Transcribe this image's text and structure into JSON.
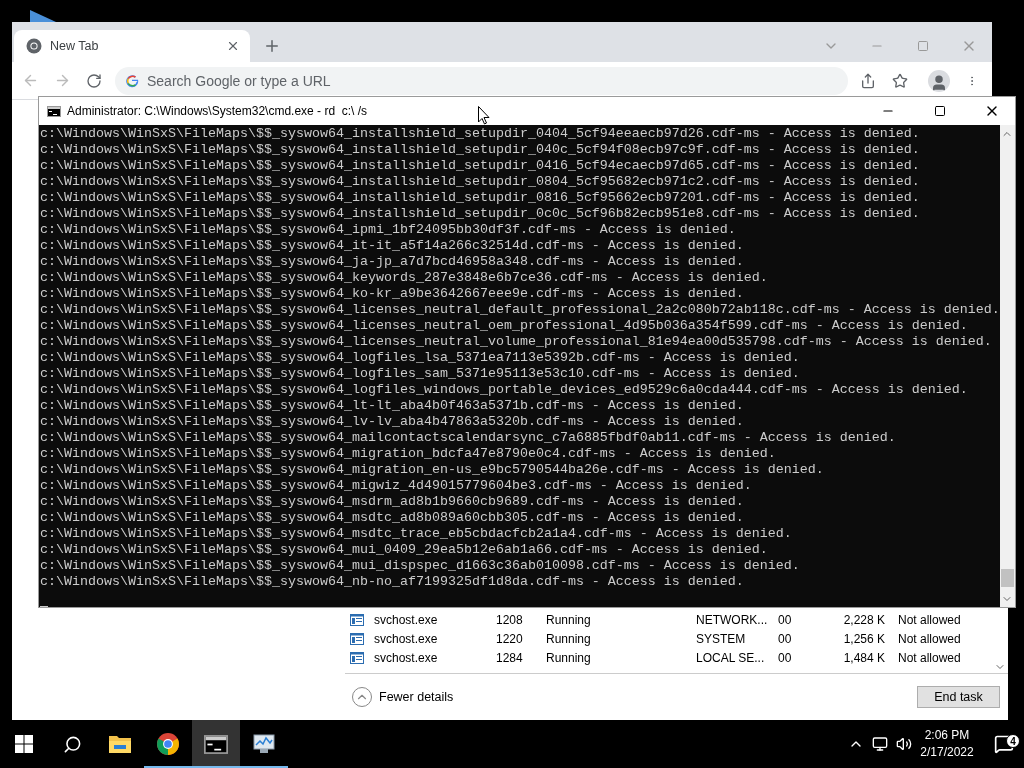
{
  "browser": {
    "tab": {
      "title": "New Tab",
      "selected": true
    },
    "omnibox": {
      "placeholder": "Search Google or type a URL"
    }
  },
  "console": {
    "title": "Administrator: C:\\Windows\\System32\\cmd.exe - rd  c:\\ /s",
    "lines": [
      "c:\\Windows\\WinSxS\\FileMaps\\$$_syswow64_installshield_setupdir_0404_5cf94eeaecb97d26.cdf-ms - Access is denied.",
      "c:\\Windows\\WinSxS\\FileMaps\\$$_syswow64_installshield_setupdir_040c_5cf94f08ecb97c9f.cdf-ms - Access is denied.",
      "c:\\Windows\\WinSxS\\FileMaps\\$$_syswow64_installshield_setupdir_0416_5cf94ecaecb97d65.cdf-ms - Access is denied.",
      "c:\\Windows\\WinSxS\\FileMaps\\$$_syswow64_installshield_setupdir_0804_5cf95682ecb971c2.cdf-ms - Access is denied.",
      "c:\\Windows\\WinSxS\\FileMaps\\$$_syswow64_installshield_setupdir_0816_5cf95662ecb97201.cdf-ms - Access is denied.",
      "c:\\Windows\\WinSxS\\FileMaps\\$$_syswow64_installshield_setupdir_0c0c_5cf96b82ecb951e8.cdf-ms - Access is denied.",
      "c:\\Windows\\WinSxS\\FileMaps\\$$_syswow64_ipmi_1bf24095bb30df3f.cdf-ms - Access is denied.",
      "c:\\Windows\\WinSxS\\FileMaps\\$$_syswow64_it-it_a5f14a266c32514d.cdf-ms - Access is denied.",
      "c:\\Windows\\WinSxS\\FileMaps\\$$_syswow64_ja-jp_a7d7bcd46958a348.cdf-ms - Access is denied.",
      "c:\\Windows\\WinSxS\\FileMaps\\$$_syswow64_keywords_287e3848e6b7ce36.cdf-ms - Access is denied.",
      "c:\\Windows\\WinSxS\\FileMaps\\$$_syswow64_ko-kr_a9be3642667eee9e.cdf-ms - Access is denied.",
      "c:\\Windows\\WinSxS\\FileMaps\\$$_syswow64_licenses_neutral_default_professional_2a2c080b72ab118c.cdf-ms - Access is denied.",
      "c:\\Windows\\WinSxS\\FileMaps\\$$_syswow64_licenses_neutral_oem_professional_4d95b036a354f599.cdf-ms - Access is denied.",
      "c:\\Windows\\WinSxS\\FileMaps\\$$_syswow64_licenses_neutral_volume_professional_81e94ea00d535798.cdf-ms - Access is denied.",
      "c:\\Windows\\WinSxS\\FileMaps\\$$_syswow64_logfiles_lsa_5371ea7113e5392b.cdf-ms - Access is denied.",
      "c:\\Windows\\WinSxS\\FileMaps\\$$_syswow64_logfiles_sam_5371e95113e53c10.cdf-ms - Access is denied.",
      "c:\\Windows\\WinSxS\\FileMaps\\$$_syswow64_logfiles_windows_portable_devices_ed9529c6a0cda444.cdf-ms - Access is denied.",
      "c:\\Windows\\WinSxS\\FileMaps\\$$_syswow64_lt-lt_aba4b0f463a5371b.cdf-ms - Access is denied.",
      "c:\\Windows\\WinSxS\\FileMaps\\$$_syswow64_lv-lv_aba4b47863a5320b.cdf-ms - Access is denied.",
      "c:\\Windows\\WinSxS\\FileMaps\\$$_syswow64_mailcontactscalendarsync_c7a6885fbdf0ab11.cdf-ms - Access is denied.",
      "c:\\Windows\\WinSxS\\FileMaps\\$$_syswow64_migration_bdcfa47e8790e0c4.cdf-ms - Access is denied.",
      "c:\\Windows\\WinSxS\\FileMaps\\$$_syswow64_migration_en-us_e9bc5790544ba26e.cdf-ms - Access is denied.",
      "c:\\Windows\\WinSxS\\FileMaps\\$$_syswow64_migwiz_4d49015779604be3.cdf-ms - Access is denied.",
      "c:\\Windows\\WinSxS\\FileMaps\\$$_syswow64_msdrm_ad8b1b9660cb9689.cdf-ms - Access is denied.",
      "c:\\Windows\\WinSxS\\FileMaps\\$$_syswow64_msdtc_ad8b089a60cbb305.cdf-ms - Access is denied.",
      "c:\\Windows\\WinSxS\\FileMaps\\$$_syswow64_msdtc_trace_eb5cbdacfcb2a1a4.cdf-ms - Access is denied.",
      "c:\\Windows\\WinSxS\\FileMaps\\$$_syswow64_mui_0409_29ea5b12e6ab1a66.cdf-ms - Access is denied.",
      "c:\\Windows\\WinSxS\\FileMaps\\$$_syswow64_mui_dispspec_d1663c36ab010098.cdf-ms - Access is denied.",
      "c:\\Windows\\WinSxS\\FileMaps\\$$_syswow64_nb-no_af7199325df1d8da.cdf-ms - Access is denied."
    ]
  },
  "task_manager": {
    "rows": [
      {
        "name": "svchost.exe",
        "pid": "1208",
        "status": "Running",
        "user": "NETWORK...",
        "cpu": "00",
        "memory": "2,228 K",
        "uac": "Not allowed"
      },
      {
        "name": "svchost.exe",
        "pid": "1220",
        "status": "Running",
        "user": "SYSTEM",
        "cpu": "00",
        "memory": "1,256 K",
        "uac": "Not allowed"
      },
      {
        "name": "svchost.exe",
        "pid": "1284",
        "status": "Running",
        "user": "LOCAL SE...",
        "cpu": "00",
        "memory": "1,484 K",
        "uac": "Not allowed"
      }
    ],
    "details_toggle": "Fewer details",
    "end_task": "End task"
  },
  "taskbar": {
    "apps": [
      {
        "kind": "explorer",
        "active": false,
        "running": false
      },
      {
        "kind": "chrome",
        "active": false,
        "running": true
      },
      {
        "kind": "console",
        "active": true,
        "running": true
      },
      {
        "kind": "taskmanager",
        "active": false,
        "running": true
      }
    ],
    "time": "2:06 PM",
    "date": "2/17/2022",
    "notifications": "4"
  }
}
